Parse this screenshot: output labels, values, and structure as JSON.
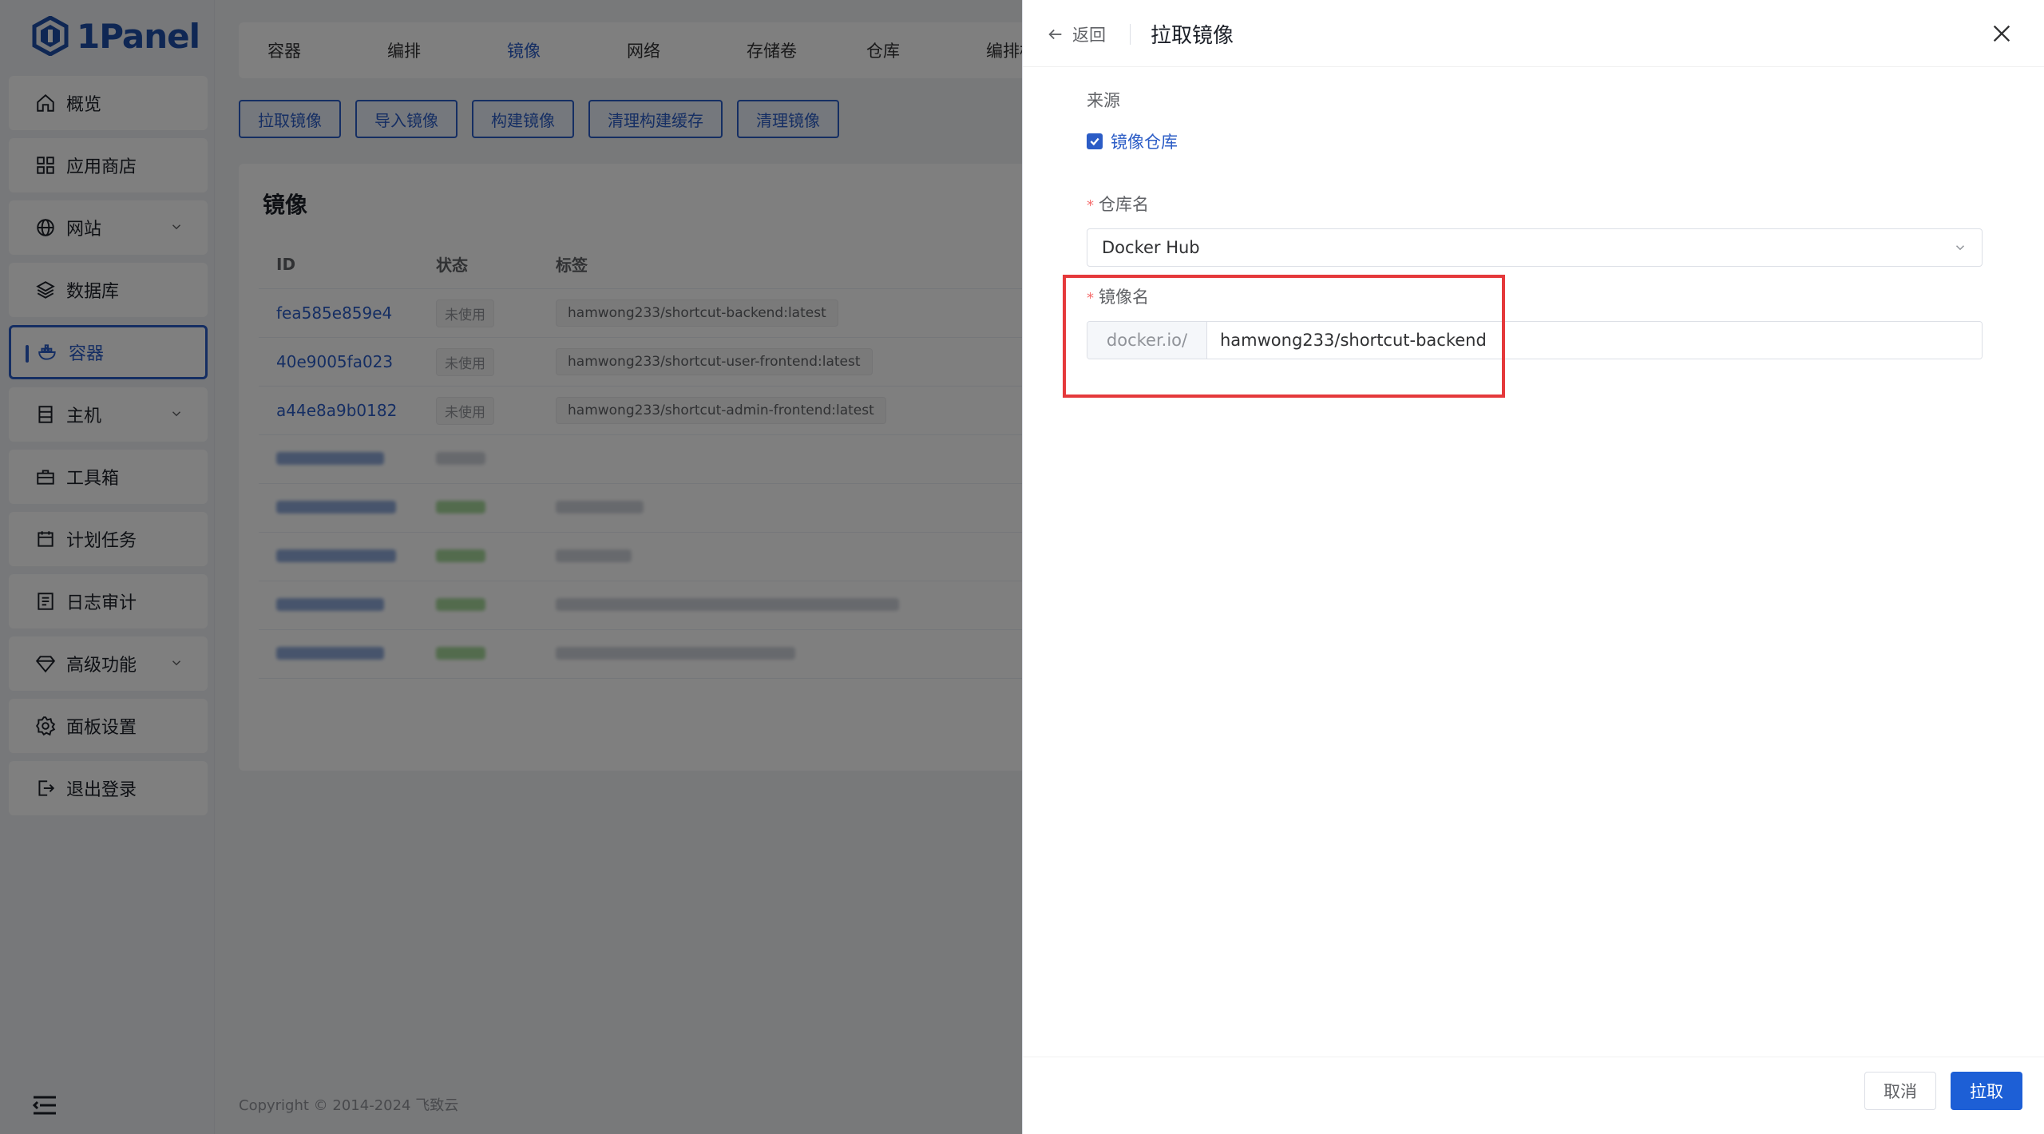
{
  "app": {
    "logo_text": "1Panel"
  },
  "sidebar": {
    "items": [
      {
        "label": "概览",
        "icon": "home-icon"
      },
      {
        "label": "应用商店",
        "icon": "grid-icon"
      },
      {
        "label": "网站",
        "icon": "globe-icon",
        "expandable": true
      },
      {
        "label": "数据库",
        "icon": "layers-icon"
      },
      {
        "label": "容器",
        "icon": "docker-icon",
        "active": true
      },
      {
        "label": "主机",
        "icon": "server-icon",
        "expandable": true
      },
      {
        "label": "工具箱",
        "icon": "toolbox-icon"
      },
      {
        "label": "计划任务",
        "icon": "calendar-icon"
      },
      {
        "label": "日志审计",
        "icon": "log-icon"
      },
      {
        "label": "高级功能",
        "icon": "diamond-icon",
        "expandable": true
      },
      {
        "label": "面板设置",
        "icon": "gear-icon"
      },
      {
        "label": "退出登录",
        "icon": "logout-icon"
      }
    ]
  },
  "main": {
    "tabs": [
      "容器",
      "编排",
      "镜像",
      "网络",
      "存储卷",
      "仓库",
      "编排模"
    ],
    "active_tab": "镜像",
    "actions": [
      "拉取镜像",
      "导入镜像",
      "构建镜像",
      "清理构建缓存",
      "清理镜像"
    ],
    "card_title": "镜像",
    "table": {
      "headers": [
        "ID",
        "状态",
        "标签"
      ],
      "rows": [
        {
          "id": "fea585e859e4",
          "status": "未使用",
          "tag": "hamwong233/shortcut-backend:latest"
        },
        {
          "id": "40e9005fa023",
          "status": "未使用",
          "tag": "hamwong233/shortcut-user-frontend:latest"
        },
        {
          "id": "a44e8a9b0182",
          "status": "未使用",
          "tag": "hamwong233/shortcut-admin-frontend:latest"
        }
      ]
    },
    "footer": "Copyright © 2014-2024 飞致云"
  },
  "drawer": {
    "back_label": "返回",
    "title": "拉取镜像",
    "source_label": "来源",
    "source_option": "镜像仓库",
    "repo_label": "仓库名",
    "repo_value": "Docker Hub",
    "image_label": "镜像名",
    "image_prefix": "docker.io/",
    "image_value": "hamwong233/shortcut-backend",
    "cancel_label": "取消",
    "pull_label": "拉取"
  },
  "colors": {
    "accent": "#2b5cc6",
    "primary_button": "#1d5fd6",
    "highlight_box": "#e5393b",
    "required": "#f56c6c"
  }
}
